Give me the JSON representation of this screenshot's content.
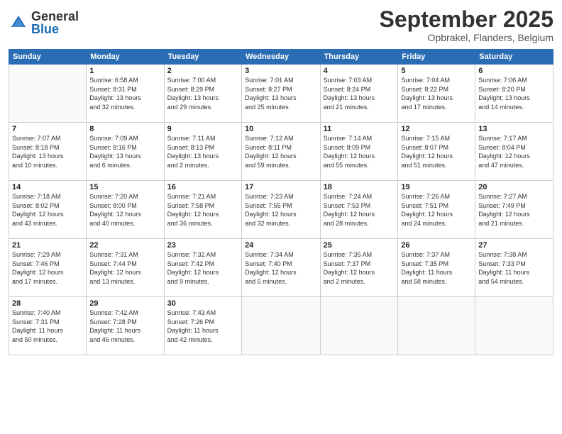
{
  "header": {
    "logo_general": "General",
    "logo_blue": "Blue",
    "month_title": "September 2025",
    "location": "Opbrakel, Flanders, Belgium"
  },
  "weekdays": [
    "Sunday",
    "Monday",
    "Tuesday",
    "Wednesday",
    "Thursday",
    "Friday",
    "Saturday"
  ],
  "weeks": [
    [
      {
        "day": "",
        "info": ""
      },
      {
        "day": "1",
        "info": "Sunrise: 6:58 AM\nSunset: 8:31 PM\nDaylight: 13 hours\nand 32 minutes."
      },
      {
        "day": "2",
        "info": "Sunrise: 7:00 AM\nSunset: 8:29 PM\nDaylight: 13 hours\nand 29 minutes."
      },
      {
        "day": "3",
        "info": "Sunrise: 7:01 AM\nSunset: 8:27 PM\nDaylight: 13 hours\nand 25 minutes."
      },
      {
        "day": "4",
        "info": "Sunrise: 7:03 AM\nSunset: 8:24 PM\nDaylight: 13 hours\nand 21 minutes."
      },
      {
        "day": "5",
        "info": "Sunrise: 7:04 AM\nSunset: 8:22 PM\nDaylight: 13 hours\nand 17 minutes."
      },
      {
        "day": "6",
        "info": "Sunrise: 7:06 AM\nSunset: 8:20 PM\nDaylight: 13 hours\nand 14 minutes."
      }
    ],
    [
      {
        "day": "7",
        "info": "Sunrise: 7:07 AM\nSunset: 8:18 PM\nDaylight: 13 hours\nand 10 minutes."
      },
      {
        "day": "8",
        "info": "Sunrise: 7:09 AM\nSunset: 8:16 PM\nDaylight: 13 hours\nand 6 minutes."
      },
      {
        "day": "9",
        "info": "Sunrise: 7:11 AM\nSunset: 8:13 PM\nDaylight: 13 hours\nand 2 minutes."
      },
      {
        "day": "10",
        "info": "Sunrise: 7:12 AM\nSunset: 8:11 PM\nDaylight: 12 hours\nand 59 minutes."
      },
      {
        "day": "11",
        "info": "Sunrise: 7:14 AM\nSunset: 8:09 PM\nDaylight: 12 hours\nand 55 minutes."
      },
      {
        "day": "12",
        "info": "Sunrise: 7:15 AM\nSunset: 8:07 PM\nDaylight: 12 hours\nand 51 minutes."
      },
      {
        "day": "13",
        "info": "Sunrise: 7:17 AM\nSunset: 8:04 PM\nDaylight: 12 hours\nand 47 minutes."
      }
    ],
    [
      {
        "day": "14",
        "info": "Sunrise: 7:18 AM\nSunset: 8:02 PM\nDaylight: 12 hours\nand 43 minutes."
      },
      {
        "day": "15",
        "info": "Sunrise: 7:20 AM\nSunset: 8:00 PM\nDaylight: 12 hours\nand 40 minutes."
      },
      {
        "day": "16",
        "info": "Sunrise: 7:21 AM\nSunset: 7:58 PM\nDaylight: 12 hours\nand 36 minutes."
      },
      {
        "day": "17",
        "info": "Sunrise: 7:23 AM\nSunset: 7:55 PM\nDaylight: 12 hours\nand 32 minutes."
      },
      {
        "day": "18",
        "info": "Sunrise: 7:24 AM\nSunset: 7:53 PM\nDaylight: 12 hours\nand 28 minutes."
      },
      {
        "day": "19",
        "info": "Sunrise: 7:26 AM\nSunset: 7:51 PM\nDaylight: 12 hours\nand 24 minutes."
      },
      {
        "day": "20",
        "info": "Sunrise: 7:27 AM\nSunset: 7:49 PM\nDaylight: 12 hours\nand 21 minutes."
      }
    ],
    [
      {
        "day": "21",
        "info": "Sunrise: 7:29 AM\nSunset: 7:46 PM\nDaylight: 12 hours\nand 17 minutes."
      },
      {
        "day": "22",
        "info": "Sunrise: 7:31 AM\nSunset: 7:44 PM\nDaylight: 12 hours\nand 13 minutes."
      },
      {
        "day": "23",
        "info": "Sunrise: 7:32 AM\nSunset: 7:42 PM\nDaylight: 12 hours\nand 9 minutes."
      },
      {
        "day": "24",
        "info": "Sunrise: 7:34 AM\nSunset: 7:40 PM\nDaylight: 12 hours\nand 5 minutes."
      },
      {
        "day": "25",
        "info": "Sunrise: 7:35 AM\nSunset: 7:37 PM\nDaylight: 12 hours\nand 2 minutes."
      },
      {
        "day": "26",
        "info": "Sunrise: 7:37 AM\nSunset: 7:35 PM\nDaylight: 11 hours\nand 58 minutes."
      },
      {
        "day": "27",
        "info": "Sunrise: 7:38 AM\nSunset: 7:33 PM\nDaylight: 11 hours\nand 54 minutes."
      }
    ],
    [
      {
        "day": "28",
        "info": "Sunrise: 7:40 AM\nSunset: 7:31 PM\nDaylight: 11 hours\nand 50 minutes."
      },
      {
        "day": "29",
        "info": "Sunrise: 7:42 AM\nSunset: 7:28 PM\nDaylight: 11 hours\nand 46 minutes."
      },
      {
        "day": "30",
        "info": "Sunrise: 7:43 AM\nSunset: 7:26 PM\nDaylight: 11 hours\nand 42 minutes."
      },
      {
        "day": "",
        "info": ""
      },
      {
        "day": "",
        "info": ""
      },
      {
        "day": "",
        "info": ""
      },
      {
        "day": "",
        "info": ""
      }
    ]
  ]
}
